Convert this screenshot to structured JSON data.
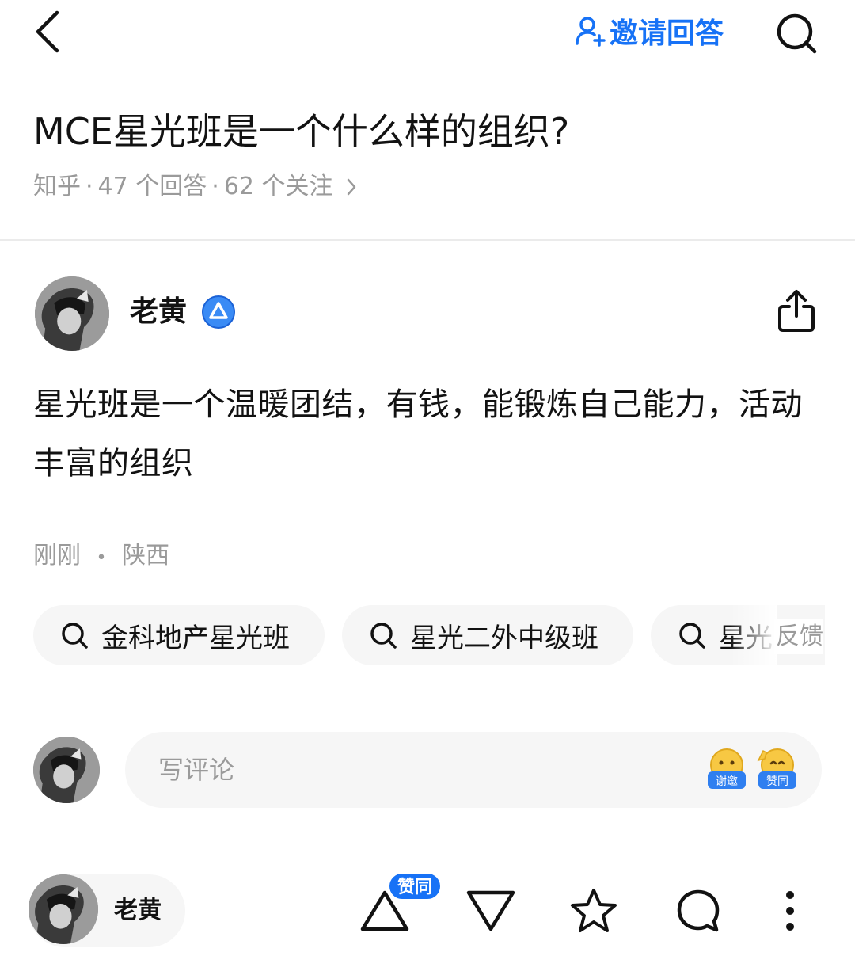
{
  "header": {
    "back_icon": "chevron-left-icon",
    "invite_label": "邀请回答",
    "invite_icon": "person-add-icon",
    "search_icon": "search-icon",
    "accent_color": "#1772f6"
  },
  "question": {
    "title": "MCE星光班是一个什么样的组织?",
    "source": "知乎",
    "separator": "·",
    "answers": "47 个回答",
    "followers": "62 个关注",
    "more_icon": "chevron-right-icon"
  },
  "answer": {
    "author_name": "老黄",
    "badge_icon": "verified-triangle-icon",
    "share_icon": "share-icon",
    "content": "星光班是一个温暖团结，有钱，能锻炼自己能力，活动丰富的组织",
    "time": "刚刚",
    "dot": "•",
    "location": "陕西"
  },
  "related_searches": {
    "items": [
      {
        "label": "金科地产星光班"
      },
      {
        "label": "星光二外中级班"
      },
      {
        "label": "星光"
      }
    ],
    "feedback_label": "反馈"
  },
  "comment": {
    "placeholder": "写评论",
    "emoji_thanks_label": "谢邀",
    "emoji_agree_label": "赞同"
  },
  "bottom_bar": {
    "author_name": "老黄",
    "upvote_badge": "赞同",
    "upvote_icon": "upvote-triangle-icon",
    "downvote_icon": "downvote-triangle-icon",
    "collect_icon": "star-icon",
    "comment_icon": "comment-bubble-icon",
    "more_icon": "more-vertical-icon"
  }
}
